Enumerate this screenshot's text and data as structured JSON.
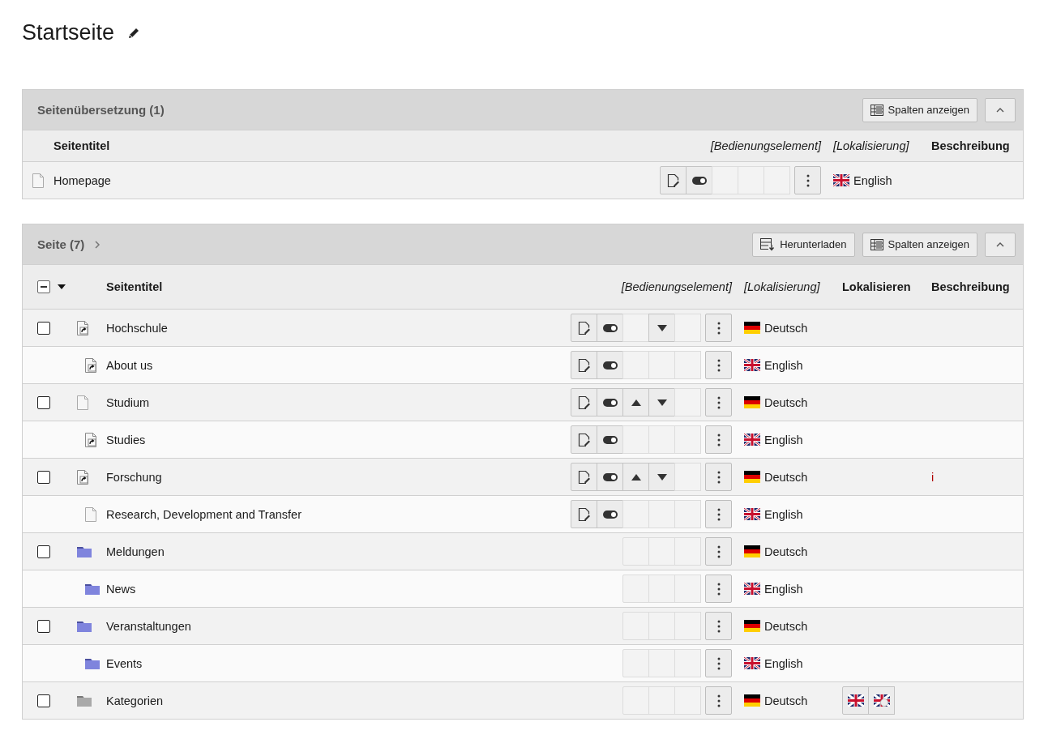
{
  "page": {
    "title": "Startseite"
  },
  "panels": [
    {
      "title": "Seitenübersetzung (1)",
      "expandable": false,
      "toolbar": [
        {
          "kind": "columns",
          "label": "Spalten anzeigen"
        },
        {
          "kind": "collapse"
        }
      ],
      "columns": [
        {
          "kind": "title",
          "label": "Seitentitel"
        },
        {
          "kind": "control",
          "label": "[Bedienungselement]"
        },
        {
          "kind": "language",
          "label": "[Lokalisierung]"
        },
        {
          "kind": "description",
          "label": "Beschreibung"
        }
      ],
      "rows": [
        {
          "title": "Homepage",
          "kind": "page",
          "actions": {
            "edit": true,
            "toggle": true,
            "move_up": false,
            "move_down": false
          },
          "language": {
            "kind": "gb",
            "label": "English"
          }
        }
      ]
    },
    {
      "title": "Seite (7)",
      "expandable": true,
      "toolbar": [
        {
          "kind": "download",
          "label": "Herunterladen"
        },
        {
          "kind": "columns",
          "label": "Spalten anzeigen"
        },
        {
          "kind": "collapse"
        }
      ],
      "select_all": {
        "indeterminate": true
      },
      "columns": [
        {
          "kind": "title",
          "label": "Seitentitel"
        },
        {
          "kind": "control",
          "label": "[Bedienungselement]"
        },
        {
          "kind": "language",
          "label": "[Lokalisierung]"
        },
        {
          "kind": "localize",
          "label": "Lokalisieren"
        },
        {
          "kind": "description",
          "label": "Beschreibung"
        }
      ],
      "rows": [
        {
          "title": "Hochschule",
          "kind": "shortcut",
          "checked": false,
          "actions": {
            "edit": true,
            "toggle": true,
            "move_up": false,
            "move_down": true
          },
          "language": {
            "kind": "de",
            "label": "Deutsch"
          },
          "children": [
            {
              "title": "About us",
              "kind": "shortcut",
              "actions": {
                "edit": true,
                "toggle": true,
                "move_up": false,
                "move_down": false
              },
              "language": {
                "kind": "gb",
                "label": "English"
              }
            }
          ]
        },
        {
          "title": "Studium",
          "kind": "page",
          "checked": false,
          "actions": {
            "edit": true,
            "toggle": true,
            "move_up": true,
            "move_down": true
          },
          "language": {
            "kind": "de",
            "label": "Deutsch"
          },
          "children": [
            {
              "title": "Studies",
              "kind": "shortcut",
              "actions": {
                "edit": true,
                "toggle": true,
                "move_up": false,
                "move_down": false
              },
              "language": {
                "kind": "gb",
                "label": "English"
              }
            }
          ]
        },
        {
          "title": "Forschung",
          "kind": "shortcut",
          "checked": false,
          "actions": {
            "edit": true,
            "toggle": true,
            "move_up": true,
            "move_down": true
          },
          "language": {
            "kind": "de",
            "label": "Deutsch"
          },
          "description": "i",
          "children": [
            {
              "title": "Research, Development and Transfer",
              "kind": "page",
              "actions": {
                "edit": true,
                "toggle": true,
                "move_up": false,
                "move_down": false
              },
              "language": {
                "kind": "gb",
                "label": "English"
              }
            }
          ]
        },
        {
          "title": "Meldungen",
          "kind": "folder",
          "checked": false,
          "actions": {
            "edit": false,
            "toggle": false,
            "move_up": false,
            "move_down": false
          },
          "language": {
            "kind": "de",
            "label": "Deutsch"
          },
          "children": [
            {
              "title": "News",
              "kind": "folder",
              "actions": {
                "edit": false,
                "toggle": false,
                "move_up": false,
                "move_down": false
              },
              "language": {
                "kind": "gb",
                "label": "English"
              }
            }
          ]
        },
        {
          "title": "Veranstaltungen",
          "kind": "folder",
          "checked": false,
          "actions": {
            "edit": false,
            "toggle": false,
            "move_up": false,
            "move_down": false
          },
          "language": {
            "kind": "de",
            "label": "Deutsch"
          },
          "children": [
            {
              "title": "Events",
              "kind": "folder",
              "actions": {
                "edit": false,
                "toggle": false,
                "move_up": false,
                "move_down": false
              },
              "language": {
                "kind": "gb",
                "label": "English"
              }
            }
          ]
        },
        {
          "title": "Kategorien",
          "kind": "sysfolder",
          "checked": false,
          "actions": {
            "edit": false,
            "toggle": false,
            "move_up": false,
            "move_down": false
          },
          "language": {
            "kind": "de",
            "label": "Deutsch"
          },
          "localize": [
            {
              "kind": "translate"
            },
            {
              "kind": "copy"
            }
          ]
        }
      ]
    }
  ]
}
